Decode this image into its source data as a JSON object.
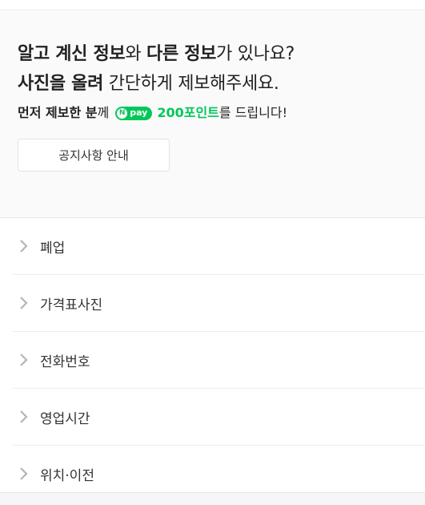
{
  "promo": {
    "line1_bold1": "알고 계신 정보",
    "line1_mid": "와 ",
    "line1_bold2": "다른 정보",
    "line1_end": "가 있나요?",
    "line2_bold": "사진을 올려",
    "line2_end": " 간단하게 제보해주세요.",
    "reward_bold": "먼저 제보한 분",
    "reward_mid": "께",
    "npay_label": "pay",
    "npay_n": "N",
    "reward_points": "200포인트",
    "reward_end": "를 드립니다!"
  },
  "notice_button": {
    "label": "공지사항 안내"
  },
  "report_items": [
    {
      "label": "폐업"
    },
    {
      "label": "가격표사진"
    },
    {
      "label": "전화번호"
    },
    {
      "label": "영업시간"
    },
    {
      "label": "위치·이전"
    }
  ],
  "colors": {
    "accent_green": "#03c75a",
    "promo_bg": "#fafafa"
  }
}
